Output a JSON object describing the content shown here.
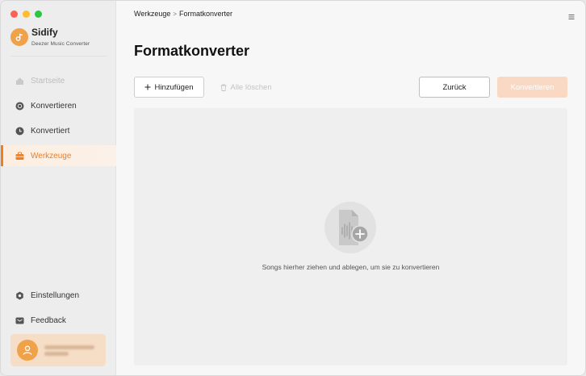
{
  "app": {
    "name": "Sidify",
    "subtitle": "Deezer Music Converter"
  },
  "sidebar": {
    "items": [
      {
        "label": "Startseite",
        "icon": "home-icon",
        "state": "disabled"
      },
      {
        "label": "Konvertieren",
        "icon": "convert-icon",
        "state": "normal"
      },
      {
        "label": "Konvertiert",
        "icon": "clock-icon",
        "state": "normal"
      },
      {
        "label": "Werkzeuge",
        "icon": "toolbox-icon",
        "state": "active"
      }
    ],
    "bottom_items": [
      {
        "label": "Einstellungen",
        "icon": "gear-icon"
      },
      {
        "label": "Feedback",
        "icon": "mail-icon"
      }
    ]
  },
  "breadcrumb": {
    "parent": "Werkzeuge",
    "separator": ">",
    "current": "Formatkonverter"
  },
  "page": {
    "title": "Formatkonverter"
  },
  "toolbar": {
    "add_label": "Hinzufügen",
    "clear_label": "Alle löschen",
    "back_label": "Zurück",
    "convert_label": "Konvertieren"
  },
  "dropzone": {
    "text": "Songs hierher ziehen und ablegen, um sie zu konvertieren"
  },
  "colors": {
    "accent": "#f07e1e",
    "logo": "#f0a24a",
    "convert_disabled": "#f9d9c3"
  }
}
